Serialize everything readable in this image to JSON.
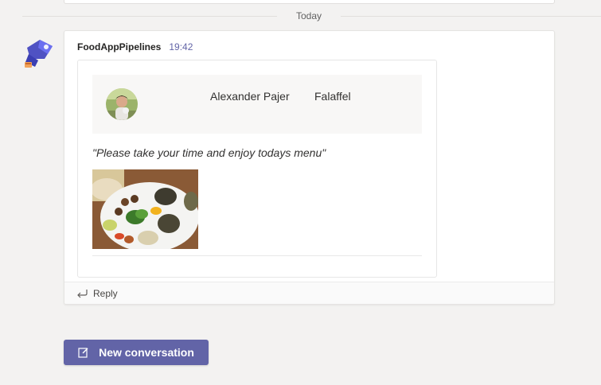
{
  "divider": {
    "label": "Today"
  },
  "message": {
    "sender": "FoodAppPipelines",
    "time": "19:42",
    "card": {
      "person_name": "Alexander Pajer",
      "dish": "Falaffel",
      "quote": "\"Please take your time and enjoy todays menu\""
    },
    "reply_label": "Reply"
  },
  "compose": {
    "button_label": "New conversation"
  },
  "colors": {
    "accent": "#6264a7",
    "background": "#f3f2f1"
  },
  "icons": {
    "bot_avatar": "bot-logo-icon",
    "reply": "reply-arrow-icon",
    "compose": "compose-icon"
  }
}
